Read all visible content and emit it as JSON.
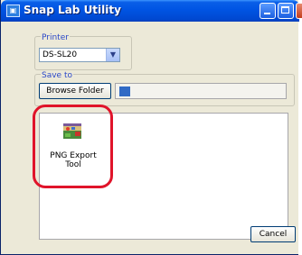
{
  "window": {
    "title": "Snap Lab Utility",
    "app_icon": "app-icon"
  },
  "printer": {
    "label": "Printer",
    "selected": "DS-SL20"
  },
  "save_to": {
    "label": "Save to",
    "browse_label": "Browse Folder"
  },
  "tools": [
    {
      "label_line1": "PNG Export",
      "label_line2": "Tool",
      "icon": "photo-tool-icon"
    }
  ],
  "footer": {
    "cancel_label": "Cancel"
  },
  "colors": {
    "titlebar": "#0054e3",
    "highlight": "#e0142a",
    "label": "#2b48c8"
  }
}
